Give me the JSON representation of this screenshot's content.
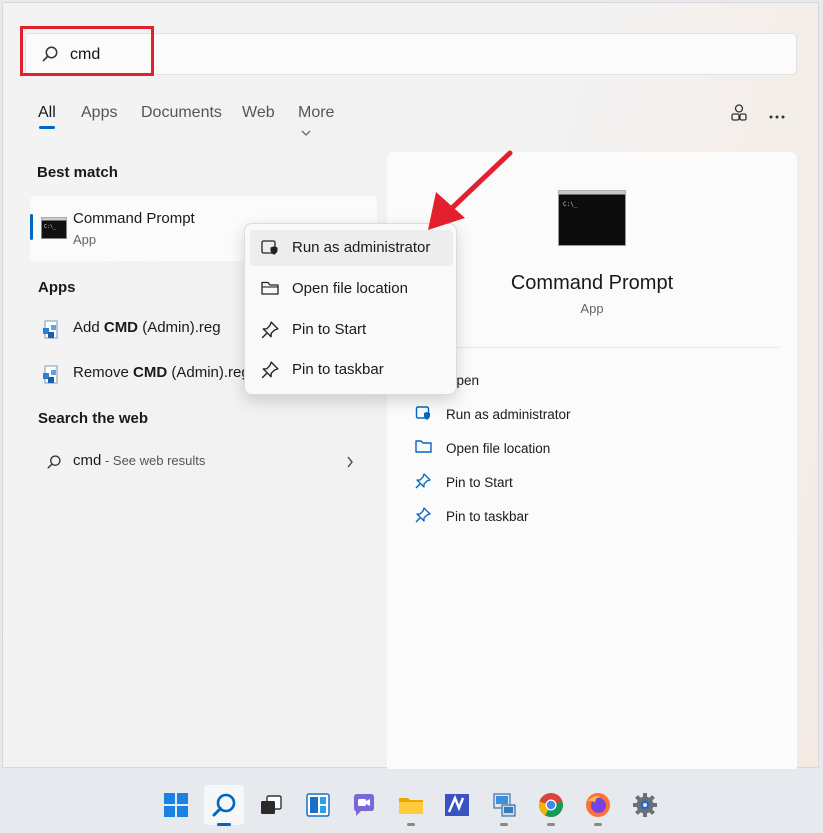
{
  "search": {
    "value": "cmd"
  },
  "tabs": [
    {
      "label": "All"
    },
    {
      "label": "Apps"
    },
    {
      "label": "Documents"
    },
    {
      "label": "Web"
    },
    {
      "label": "More"
    }
  ],
  "top_icons": {
    "feedback": "people-icon",
    "more": "ellipsis-icon"
  },
  "best_match": {
    "heading": "Best match",
    "name": "Command Prompt",
    "type": "App"
  },
  "apps": {
    "heading": "Apps",
    "items": [
      {
        "prefix": "Add ",
        "bold": "CMD",
        "suffix": " (Admin).reg"
      },
      {
        "prefix": "Remove ",
        "bold": "CMD",
        "suffix": " (Admin).reg"
      }
    ]
  },
  "web": {
    "heading": "Search the web",
    "query": "cmd",
    "hint": " - See web results"
  },
  "context_menu": [
    {
      "label": "Run as administrator",
      "icon": "shield-icon"
    },
    {
      "label": "Open file location",
      "icon": "folder-icon"
    },
    {
      "label": "Pin to Start",
      "icon": "pin-icon"
    },
    {
      "label": "Pin to taskbar",
      "icon": "pin-icon"
    }
  ],
  "right_pane": {
    "title": "Command Prompt",
    "subtitle": "App",
    "actions": [
      {
        "label": "Open",
        "icon": "open-icon"
      },
      {
        "label": "Run as administrator",
        "icon": "shield-icon"
      },
      {
        "label": "Open file location",
        "icon": "folder-icon"
      },
      {
        "label": "Pin to Start",
        "icon": "pin-icon"
      },
      {
        "label": "Pin to taskbar",
        "icon": "pin-icon"
      }
    ]
  },
  "taskbar": [
    {
      "name": "start",
      "icon": "windows-logo-icon"
    },
    {
      "name": "search",
      "icon": "search-icon"
    },
    {
      "name": "task-view",
      "icon": "task-view-icon"
    },
    {
      "name": "widgets",
      "icon": "widgets-icon"
    },
    {
      "name": "chat",
      "icon": "chat-icon"
    },
    {
      "name": "file-explorer",
      "icon": "folder-icon"
    },
    {
      "name": "visual-studio",
      "icon": "vs-icon"
    },
    {
      "name": "network",
      "icon": "network-icon"
    },
    {
      "name": "chrome",
      "icon": "chrome-icon"
    },
    {
      "name": "firefox",
      "icon": "firefox-icon"
    },
    {
      "name": "settings",
      "icon": "gear-icon"
    }
  ],
  "colors": {
    "accent": "#0067c0",
    "annotation": "#e3202e"
  }
}
